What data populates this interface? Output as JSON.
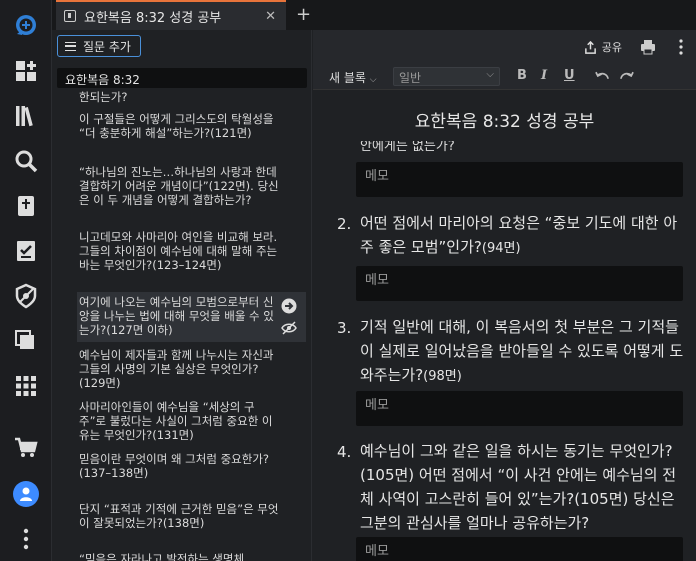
{
  "tab": {
    "title": "요한복음 8:32 성경 공부",
    "close": "✕",
    "new": "+"
  },
  "panel": {
    "add_question": "질문 추가",
    "search_value": "요한복음 8:32",
    "questions": [
      "한되는가?",
      "이 구절들은 어떻게 그리스도의 탁월성을 “더 충분하게 해설”하는가?(121면)",
      "“하나님의 진노는…하나님의 사랑과 한데 결합하기 어려운 개념이다”(122면). 당신은 이 두 개념을 어떻게 결합하는가?",
      "니고데모와 사마리아 여인을 비교해 보라. 그들의 차이점이 예수님에 대해 말해 주는 바는 무엇인가?(123–124면)",
      "여기에 나오는 예수님의 모범으로부터 신앙을 나누는 법에 대해 무엇을 배울 수 있는가?(127면 이하)",
      "예수님이 제자들과 함께 나누시는 자신과 그들의 사명의 기본 실상은 무엇인가?(129면)",
      "사마리아인들이 예수님을 “세상의 구주”로 불렀다는 사실이 그처럼 중요한 이유는 무엇인가?(131면)",
      "믿음이란 무엇이며 왜 그처럼 중요한가?(137–138면)",
      "단지 “표적과 기적에 근거한 믿음”은 무엇이 잘못되었는가?(138면)",
      "“믿음은 자라나고 발전하는 생명체"
    ]
  },
  "toolbar": {
    "share": "공유",
    "new_block": "새 블록",
    "style": "일반",
    "bold": "B",
    "italic": "I",
    "underline": "U"
  },
  "doc": {
    "title": "요한복음 8:32 성경 공부",
    "partial_top": "안에게는 없는가?",
    "memo_label": "메모",
    "items": [
      {
        "num": "2.",
        "text": "어떤 점에서 마리아의 요청은 “중보 기도에 대한 아주 좋은 모범”인가?",
        "ref": "(94면)"
      },
      {
        "num": "3.",
        "text": "기적 일반에 대해, 이 복음서의 첫 부분은 그 기적들이 실제로 일어났음을 받아들일 수 있도록 어떻게 도와주는가?",
        "ref": "(98면)"
      },
      {
        "num": "4.",
        "text": "예수님이 그와 같은 일을 하시는 동기는 무엇인가?(105면) 어떤 점에서 “이 사건 안에는 예수님의 전체 사역이 고스란히 들어 있”는가?(105면) 당신은 그분의 관심사를 얼마나 공유하는가?",
        "ref": ""
      }
    ]
  },
  "colors": {
    "accent": "#4a90d9",
    "tab_accent": "#e8743b",
    "avatar": "#3d8bff"
  }
}
